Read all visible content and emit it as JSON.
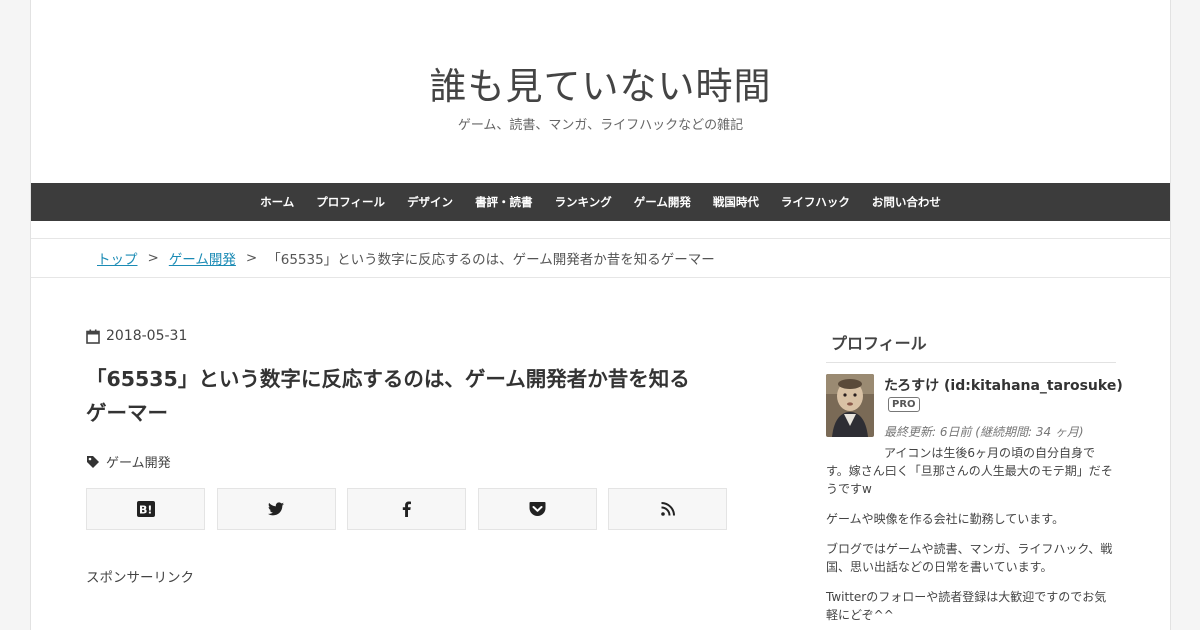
{
  "site": {
    "title": "誰も見ていない時間",
    "description": "ゲーム、読書、マンガ、ライフハックなどの雑記"
  },
  "nav": {
    "items": [
      {
        "label": "ホーム"
      },
      {
        "label": "プロフィール"
      },
      {
        "label": "デザイン"
      },
      {
        "label": "書評・読書"
      },
      {
        "label": "ランキング"
      },
      {
        "label": "ゲーム開発"
      },
      {
        "label": "戦国時代"
      },
      {
        "label": "ライフハック"
      },
      {
        "label": "お問い合わせ"
      }
    ]
  },
  "breadcrumb": {
    "top": "トップ",
    "sep": ">",
    "category": "ゲーム開発",
    "current": "「65535」という数字に反応するのは、ゲーム開発者か昔を知るゲーマー"
  },
  "entry": {
    "date": "2018-05-31",
    "title_line1": "「65535」という数字に反応するのは、ゲーム開発者か昔を知る",
    "title_line2": "ゲーマー",
    "category": "ゲーム開発",
    "sponsor": "スポンサーリンク"
  },
  "share": {
    "buttons": [
      {
        "icon": "hatena-bookmark-icon"
      },
      {
        "icon": "twitter-icon"
      },
      {
        "icon": "facebook-icon"
      },
      {
        "icon": "pocket-icon"
      },
      {
        "icon": "rss-icon"
      }
    ]
  },
  "sidebar": {
    "title": "プロフィール",
    "name": "たろすけ (id:kitahana_tarosuke)",
    "badge": "PRO",
    "last_update": "最終更新: 6日前 (継続期間: 34 ヶ月)",
    "bio1": "アイコンは生後6ヶ月の頃の自分自身です。嫁さん曰く「旦那さんの人生最大のモテ期」だそうですw",
    "bio2": "ゲームや映像を作る会社に勤務しています。",
    "bio3": "ブログではゲームや読書、マンガ、ライフハック、戦国、思い出話などの日常を書いています。",
    "bio4": "Twitterのフォローや読者登録は大歓迎ですのでお気軽にどぞ^^"
  },
  "colors": {
    "nav_bg": "#3c3c3c",
    "link": "#1b8bb5"
  }
}
